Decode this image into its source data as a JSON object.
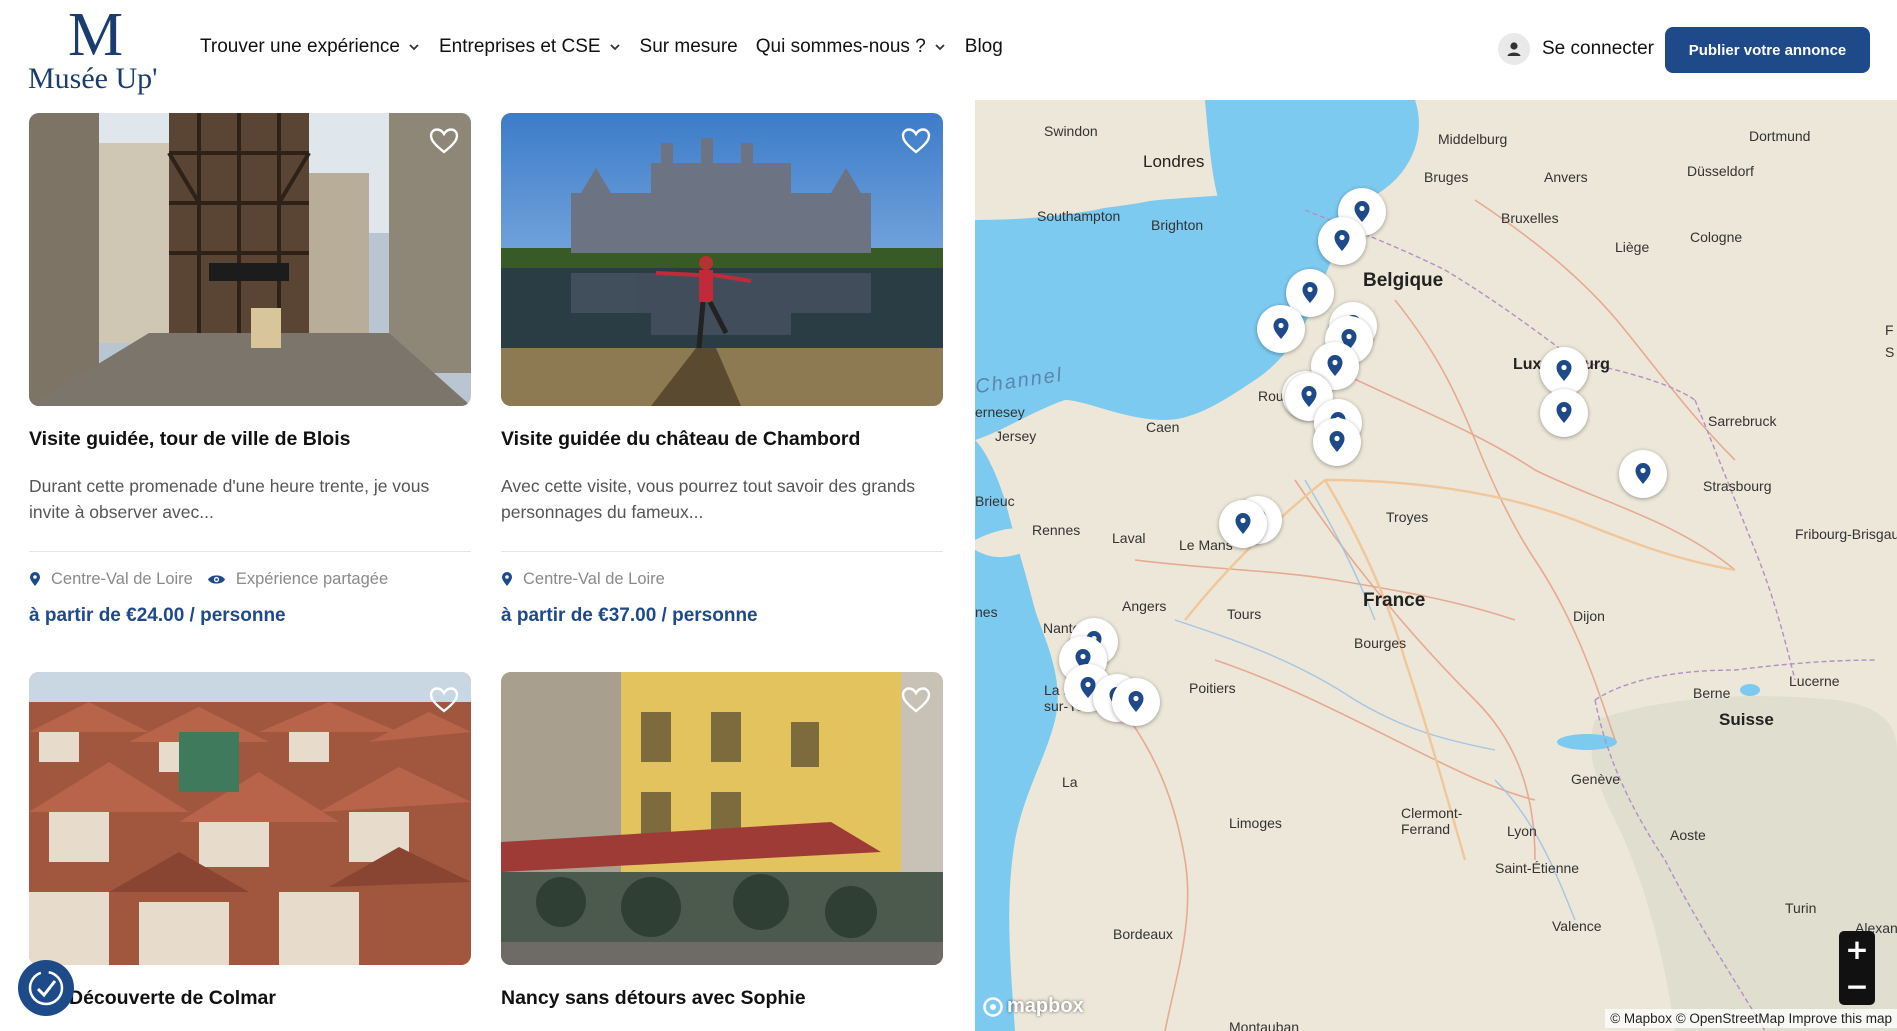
{
  "header": {
    "logo_text": "Musée Up'",
    "logo_mark": "M",
    "nav": [
      {
        "label": "Trouver une expérience",
        "dropdown": true
      },
      {
        "label": "Entreprises et CSE",
        "dropdown": true
      },
      {
        "label": "Sur mesure",
        "dropdown": false
      },
      {
        "label": "Qui sommes-nous ?",
        "dropdown": true
      },
      {
        "label": "Blog",
        "dropdown": false
      }
    ],
    "login_label": "Se connecter",
    "publish_label": "Publier votre annonce"
  },
  "listings": [
    {
      "title": "Visite guidée, tour de ville de Blois",
      "description": "Durant cette promenade d'une heure trente, je vous invite à observer avec...",
      "region": "Centre-Val de Loire",
      "shared": "Expérience partagée",
      "price": "à partir de €24.00 / personne"
    },
    {
      "title": "Visite guidée du château de Chambord",
      "description": "Avec cette visite, vous pourrez tout savoir des grands personnages du fameux...",
      "region": "Centre-Val de Loire",
      "price": "à partir de €37.00 / personne"
    },
    {
      "title": "Découverte de Colmar"
    },
    {
      "title": "Nancy sans détours avec Sophie"
    }
  ],
  "map": {
    "countries": [
      "France",
      "Belgique",
      "Luxembourg",
      "Suisse"
    ],
    "sea": "Channel",
    "cities": [
      "Swindon",
      "Londres",
      "Southampton",
      "Brighton",
      "Middelburg",
      "Dortmund",
      "Bruges",
      "Anvers",
      "Düsseldorf",
      "Bruxelles",
      "Cologne",
      "Liège",
      "Rouen",
      "Caen",
      "Jersey",
      "ernesey",
      "Sarrebruck",
      "Strasbourg",
      "Fribourg-Brisgau",
      "Rennes",
      "Laval",
      "Le Mans",
      "Troyes",
      "Brieuc",
      "Angers",
      "Tours",
      "Nantes",
      "Dijon",
      "Bourges",
      "La Roche-sur-Yon",
      "Poitiers",
      "Berne",
      "Lucerne",
      "Genève",
      "Limoges",
      "Clermont-Ferrand",
      "Lyon",
      "Aoste",
      "Saint-Étienne",
      "Turin",
      "Valence",
      "Bordeaux",
      "Alexandr",
      "Montauban",
      "nes",
      "La",
      "F",
      "S"
    ],
    "zoom_in": "+",
    "zoom_out": "−",
    "logo": "mapbox",
    "attribution": "© Mapbox © OpenStreetMap  Improve this map"
  },
  "colors": {
    "brand": "#1e4a8a",
    "water": "#7ccaf0",
    "land": "#ece7d8"
  }
}
